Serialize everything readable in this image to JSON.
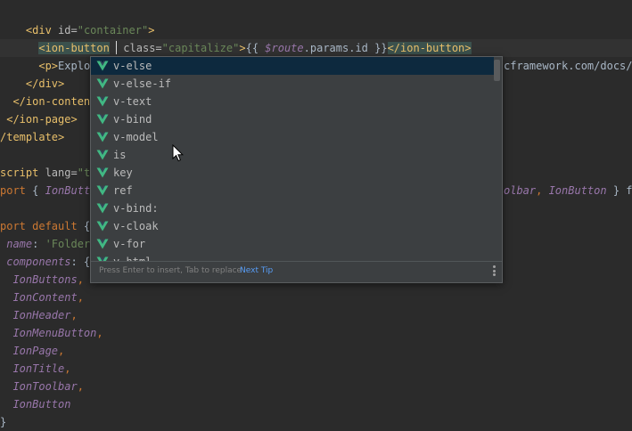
{
  "code": {
    "l1": {
      "indent": "    ",
      "lt": "<",
      "tag": "div",
      "attr": " id=",
      "val": "\"container\"",
      "gt": ">"
    },
    "l2": {
      "indent": "      ",
      "open": "<ion-button",
      "after": " class=",
      "val": "\"capitalize\"",
      "gt": ">",
      "mustache": "{{ ",
      "expr": "$route",
      "expr2": ".params.id",
      "mustache_end": " }}",
      "close": "</ion-button>"
    },
    "l3": {
      "indent": "      ",
      "open": "<p>",
      "text": "Explo",
      "right": "cframework.com/docs/c"
    },
    "l4": {
      "indent": "    ",
      "close": "</div>"
    },
    "l5": {
      "indent": "  ",
      "close": "</ion-conten"
    },
    "l6": {
      "indent": " ",
      "close": "</ion-page>"
    },
    "l7": {
      "close": "/template>"
    },
    "l8": {
      "kw": "script",
      "attr": " lang=",
      "val": "\"ts"
    },
    "l9": {
      "kw": "port",
      "brace": " { ",
      "name": "IonButt",
      "right_a": "olbar",
      "right_b": ", ",
      "right_c": "IonButton",
      "right_d": " } f"
    },
    "l10": {
      "kw": "port default",
      "brace": " {"
    },
    "l11": {
      "key": " name",
      "colon": ": ",
      "val": "'Folder'"
    },
    "l12": {
      "key": " components",
      "colon": ": {"
    },
    "l13": {
      "name": "IonButtons",
      "comma": ","
    },
    "l14": {
      "name": "IonContent",
      "comma": ","
    },
    "l15": {
      "name": "IonHeader",
      "comma": ","
    },
    "l16": {
      "name": "IonMenuButton",
      "comma": ","
    },
    "l17": {
      "name": "IonPage",
      "comma": ","
    },
    "l18": {
      "name": "IonTitle",
      "comma": ","
    },
    "l19": {
      "name": "IonToolbar",
      "comma": ","
    },
    "l20": {
      "name": "IonButton"
    },
    "l21": {
      "close": "}"
    }
  },
  "autocomplete": {
    "items": [
      "v-else",
      "v-else-if",
      "v-text",
      "v-bind",
      "v-model",
      "is",
      "key",
      "ref",
      "v-bind:",
      "v-cloak",
      "v-for",
      "v-html"
    ],
    "selected_index": 0,
    "icon": "vue-logo-icon",
    "footer_hint": "Press Enter to insert, Tab to replace",
    "footer_link": "Next Tip",
    "menu_icon": "more-vertical-icon"
  },
  "colors": {
    "background": "#2b2b2b",
    "popup": "#3c3f41",
    "selection": "#0d293e",
    "vue_green": "#41b883",
    "tag": "#e8bf6a",
    "string": "#6a8759",
    "keyword": "#cc7832",
    "italic_name": "#9876aa",
    "link": "#589df6"
  }
}
